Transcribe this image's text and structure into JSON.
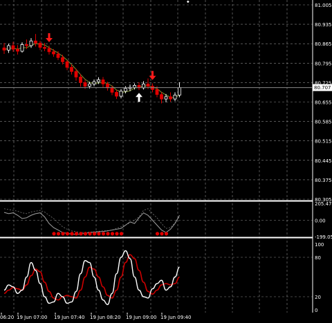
{
  "colors": {
    "background": "#000000",
    "grid": "#8a8a8a",
    "frame": "#ffffff",
    "bull": "#ffffff",
    "bear": "#e00000",
    "ma": "#6b7d2a",
    "arrow_down": "#ff1a1a",
    "arrow_up": "#ffffff",
    "cci": "#a0a0a0",
    "stoch_main": "#ffffff",
    "stoch_signal": "#cc0000"
  },
  "price_panel": {
    "axis_labels": [
      "81.005",
      "80.935",
      "80.865",
      "80.795",
      "80.725",
      "80.655",
      "80.585",
      "80.515",
      "80.445",
      "80.375",
      "80.305"
    ],
    "current_price": "80.707",
    "ylim": [
      80.305,
      81.005
    ]
  },
  "cci_panel": {
    "axis_labels": [
      "205.474",
      "0.00",
      "-199.05"
    ],
    "ylim": [
      -199.05,
      205.474
    ]
  },
  "stoch_panel": {
    "axis_labels": [
      "100",
      "80",
      "20",
      "0"
    ],
    "ylim": [
      0,
      100
    ]
  },
  "time_axis": {
    "labels": [
      "06:20",
      "19 Jun 07:00",
      "19 Jun 07:40",
      "19 Jun 08:20",
      "19 Jun 09:00",
      "19 Jun 09:40"
    ]
  },
  "chart_data": [
    {
      "type": "candlestick",
      "ylim": [
        80.305,
        81.005
      ],
      "candles": [
        {
          "o": 80.85,
          "h": 80.868,
          "c": 80.842,
          "l": 80.828
        },
        {
          "o": 80.842,
          "h": 80.865,
          "c": 80.858,
          "l": 80.832
        },
        {
          "o": 80.858,
          "h": 80.872,
          "c": 80.845,
          "l": 80.836
        },
        {
          "o": 80.845,
          "h": 80.86,
          "c": 80.838,
          "l": 80.826
        },
        {
          "o": 80.838,
          "h": 80.87,
          "c": 80.862,
          "l": 80.833
        },
        {
          "o": 80.862,
          "h": 80.88,
          "c": 80.858,
          "l": 80.846
        },
        {
          "o": 80.858,
          "h": 80.885,
          "c": 80.875,
          "l": 80.85
        },
        {
          "o": 80.875,
          "h": 80.9,
          "c": 80.867,
          "l": 80.855
        },
        {
          "o": 80.867,
          "h": 80.875,
          "c": 80.852,
          "l": 80.842
        },
        {
          "o": 80.852,
          "h": 80.868,
          "c": 80.848,
          "l": 80.838
        },
        {
          "o": 80.848,
          "h": 80.858,
          "c": 80.836,
          "l": 80.826
        },
        {
          "o": 80.836,
          "h": 80.846,
          "c": 80.828,
          "l": 80.818
        },
        {
          "o": 80.828,
          "h": 80.838,
          "c": 80.815,
          "l": 80.806
        },
        {
          "o": 80.815,
          "h": 80.825,
          "c": 80.8,
          "l": 80.79
        },
        {
          "o": 80.8,
          "h": 80.806,
          "c": 80.78,
          "l": 80.77
        },
        {
          "o": 80.78,
          "h": 80.79,
          "c": 80.765,
          "l": 80.754
        },
        {
          "o": 80.765,
          "h": 80.775,
          "c": 80.745,
          "l": 80.732
        },
        {
          "o": 80.745,
          "h": 80.755,
          "c": 80.725,
          "l": 80.71
        },
        {
          "o": 80.725,
          "h": 80.735,
          "c": 80.712,
          "l": 80.702
        },
        {
          "o": 80.712,
          "h": 80.728,
          "c": 80.72,
          "l": 80.704
        },
        {
          "o": 80.72,
          "h": 80.736,
          "c": 80.728,
          "l": 80.712
        },
        {
          "o": 80.728,
          "h": 80.744,
          "c": 80.735,
          "l": 80.72
        },
        {
          "o": 80.735,
          "h": 80.745,
          "c": 80.72,
          "l": 80.708
        },
        {
          "o": 80.72,
          "h": 80.728,
          "c": 80.706,
          "l": 80.696
        },
        {
          "o": 80.706,
          "h": 80.714,
          "c": 80.69,
          "l": 80.68
        },
        {
          "o": 80.69,
          "h": 80.698,
          "c": 80.676,
          "l": 80.666
        },
        {
          "o": 80.676,
          "h": 80.702,
          "c": 80.694,
          "l": 80.668
        },
        {
          "o": 80.694,
          "h": 80.712,
          "c": 80.704,
          "l": 80.686
        },
        {
          "o": 80.704,
          "h": 80.718,
          "c": 80.708,
          "l": 80.694
        },
        {
          "o": 80.708,
          "h": 80.722,
          "c": 80.715,
          "l": 80.7
        },
        {
          "o": 80.715,
          "h": 80.726,
          "c": 80.706,
          "l": 80.698
        },
        {
          "o": 80.706,
          "h": 80.73,
          "c": 80.72,
          "l": 80.7
        },
        {
          "o": 80.72,
          "h": 80.74,
          "c": 80.712,
          "l": 80.702
        },
        {
          "o": 80.712,
          "h": 80.722,
          "c": 80.7,
          "l": 80.69
        },
        {
          "o": 80.7,
          "h": 80.712,
          "c": 80.682,
          "l": 80.672
        },
        {
          "o": 80.682,
          "h": 80.69,
          "c": 80.666,
          "l": 80.65
        },
        {
          "o": 80.666,
          "h": 80.684,
          "c": 80.674,
          "l": 80.654
        },
        {
          "o": 80.674,
          "h": 80.69,
          "c": 80.666,
          "l": 80.656
        },
        {
          "o": 80.666,
          "h": 80.69,
          "c": 80.68,
          "l": 80.658
        },
        {
          "o": 80.68,
          "h": 80.726,
          "c": 80.707,
          "l": 80.672
        }
      ],
      "arrows": [
        {
          "index": 10,
          "direction": "down"
        },
        {
          "index": 33,
          "direction": "down"
        },
        {
          "index": 30,
          "direction": "up"
        }
      ],
      "current_price": 80.707
    },
    {
      "type": "line",
      "title": "CCI",
      "ylim": [
        -199.05,
        205.474
      ],
      "series": [
        {
          "values": [
            95,
            80,
            90,
            60,
            20,
            30,
            60,
            80,
            90,
            40,
            -40,
            -90,
            -120,
            -150,
            -160,
            -170,
            -175,
            -168,
            -160,
            -150,
            -145,
            -140,
            -138,
            -130,
            -120,
            -110,
            -100,
            -60,
            -20,
            -40,
            30,
            90,
            60,
            0,
            -60,
            -120,
            -150,
            -110,
            -40,
            60
          ]
        }
      ],
      "signal_band": [
        {
          "values": [
            140,
            130,
            120,
            110,
            90,
            80,
            100,
            110,
            120,
            100,
            60,
            20,
            -30,
            -80,
            -110,
            -130,
            -140,
            -150,
            -148,
            -146,
            -140,
            -135,
            -130,
            -125,
            -120,
            -100,
            -80,
            -60,
            -30,
            0,
            40,
            120,
            140,
            80,
            30,
            -40,
            -100,
            -90,
            -30,
            40
          ]
        }
      ],
      "markers": [
        11,
        12,
        13,
        14,
        15,
        16,
        17,
        18,
        19,
        20,
        21,
        22,
        23,
        24,
        25,
        26,
        34,
        35,
        36
      ]
    },
    {
      "type": "line",
      "title": "Stochastic",
      "ylim": [
        0,
        100
      ],
      "series": [
        {
          "name": "main",
          "values": [
            30,
            38,
            35,
            25,
            30,
            50,
            72,
            60,
            40,
            20,
            10,
            12,
            25,
            20,
            10,
            12,
            28,
            55,
            75,
            72,
            50,
            30,
            15,
            8,
            25,
            55,
            80,
            90,
            78,
            50,
            30,
            20,
            18,
            32,
            40,
            45,
            30,
            35,
            50,
            65
          ]
        },
        {
          "name": "signal",
          "values": [
            25,
            30,
            34,
            32,
            30,
            38,
            52,
            62,
            58,
            42,
            28,
            18,
            15,
            20,
            22,
            20,
            18,
            30,
            50,
            65,
            62,
            50,
            35,
            22,
            18,
            30,
            50,
            72,
            84,
            78,
            60,
            42,
            28,
            24,
            30,
            38,
            40,
            38,
            40,
            50
          ]
        }
      ]
    }
  ]
}
